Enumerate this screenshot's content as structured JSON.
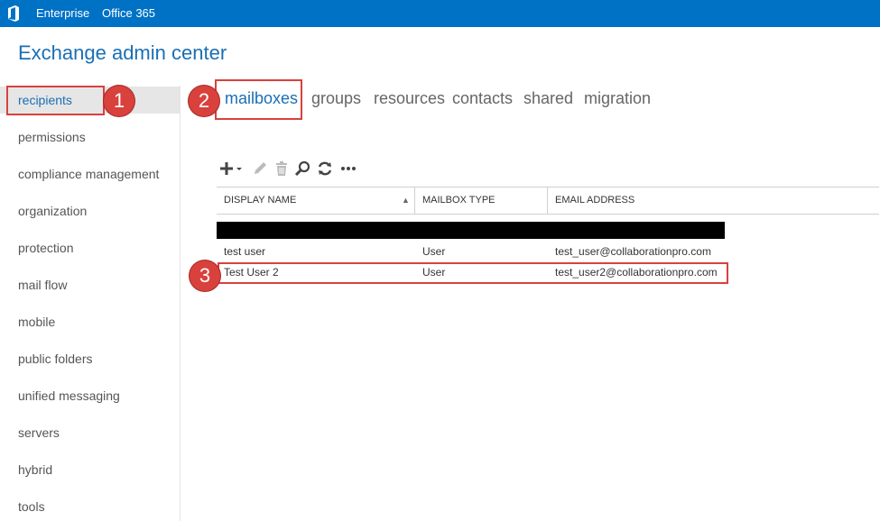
{
  "topbar": {
    "logo_icon": "office-logo-icon",
    "nav": [
      "Enterprise",
      "Office 365"
    ]
  },
  "app": {
    "title": "Exchange admin center"
  },
  "sidebar": {
    "items": [
      {
        "label": "recipients",
        "selected": true
      },
      {
        "label": "permissions"
      },
      {
        "label": "compliance management"
      },
      {
        "label": "organization"
      },
      {
        "label": "protection"
      },
      {
        "label": "mail flow"
      },
      {
        "label": "mobile"
      },
      {
        "label": "public folders"
      },
      {
        "label": "unified messaging"
      },
      {
        "label": "servers"
      },
      {
        "label": "hybrid"
      },
      {
        "label": "tools"
      }
    ]
  },
  "tabs": [
    {
      "label": "mailboxes",
      "active": true
    },
    {
      "label": "groups"
    },
    {
      "label": "resources"
    },
    {
      "label": "contacts"
    },
    {
      "label": "shared"
    },
    {
      "label": "migration"
    }
  ],
  "toolbar": {
    "icons": [
      "add-icon",
      "edit-icon",
      "delete-icon",
      "search-icon",
      "refresh-icon",
      "more-icon"
    ]
  },
  "grid": {
    "columns": [
      "DISPLAY NAME",
      "MAILBOX TYPE",
      "EMAIL ADDRESS"
    ],
    "sort_indicator": "▲",
    "rows": [
      {
        "display_name": "test user",
        "mailbox_type": "User",
        "email": "test_user@collaborationpro.com"
      },
      {
        "display_name": "Test User 2",
        "mailbox_type": "User",
        "email": "test_user2@collaborationpro.com"
      }
    ]
  },
  "callouts": [
    "1",
    "2",
    "3"
  ],
  "colors": {
    "topbar": "#0072c6",
    "accent": "#1a6fb5",
    "callout": "#d9413d",
    "selected_bg": "#e6e6e6"
  }
}
